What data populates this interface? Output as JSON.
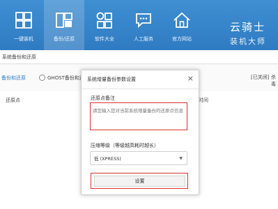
{
  "nav": {
    "items": [
      {
        "label": "一键装机",
        "icon": "grid-icon"
      },
      {
        "label": "备份/还原",
        "icon": "backup-icon"
      },
      {
        "label": "软件大全",
        "icon": "apps-icon"
      },
      {
        "label": "人工服务",
        "icon": "chat-icon"
      },
      {
        "label": "官方网站",
        "icon": "home-icon"
      }
    ],
    "active_index": 1,
    "brand_line1": "云骑士",
    "brand_line2": "装机大师"
  },
  "crumb": "系统备份和还原",
  "tabs": {
    "tab1": "备份和还原",
    "tab2": "GHOST备份和还原",
    "status": "[已关闭]",
    "more": "杀毒"
  },
  "columns": {
    "c1": "还原点",
    "c2": "时间"
  },
  "dialog": {
    "title": "系统增量备份参数设置",
    "close": "×",
    "note_label": "还原点备注",
    "note_placeholder": "请您输入您对当前系统增量备份的还原点信息",
    "level_label": "压缩等级（等级越高耗时越长）",
    "level_value": "低 (XPRESS)",
    "submit": "设置"
  },
  "colors": {
    "accent": "#2f7bc2",
    "highlight": "#d9312b"
  }
}
